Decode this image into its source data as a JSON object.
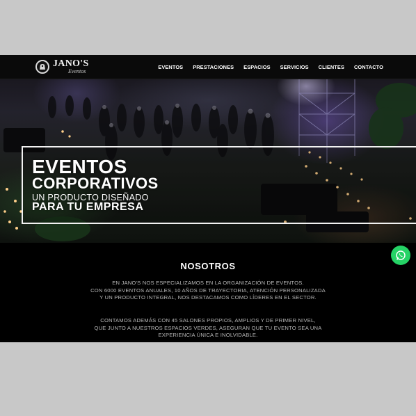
{
  "brand": {
    "name": "JANO'S",
    "sub": "Eventos"
  },
  "nav": [
    "EVENTOS",
    "PRESTACIONES",
    "ESPACIOS",
    "SERVICIOS",
    "CLIENTES",
    "CONTACTO"
  ],
  "hero": {
    "line1": "EVENTOS",
    "line2": "CORPORATIVOS",
    "line3": "UN PRODUCTO DISEÑADO",
    "line4": "PARA TU EMPRESA"
  },
  "about": {
    "title": "NOSOTROS",
    "paragraph1": [
      "EN JANO'S NOS ESPECIALIZAMOS EN LA ORGANIZACIÓN DE EVENTOS.",
      "CON 6000 EVENTOS ANUALES, 10 AÑOS DE TRAYECTORIA, ATENCIÓN PERSONALIZADA",
      "Y UN PRODUCTO INTEGRAL, NOS DESTACAMOS COMO LÍDERES EN EL SECTOR."
    ],
    "paragraph2": [
      "CONTAMOS ADEMÁS CON 45 SALONES PROPIOS, AMPLIOS Y DE PRIMER NIVEL,",
      "QUE JUNTO A NUESTROS ESPACIOS VERDES, ASEGURAN QUE TU EVENTO SEA UNA",
      "EXPERIENCIA ÚNICA E INOLVIDABLE."
    ]
  },
  "icons": {
    "whatsapp": "whatsapp-icon",
    "logo": "logo-emblem-icon"
  },
  "colors": {
    "whatsapp": "#25d366",
    "background": "#000000",
    "accent": "#ffffff"
  }
}
